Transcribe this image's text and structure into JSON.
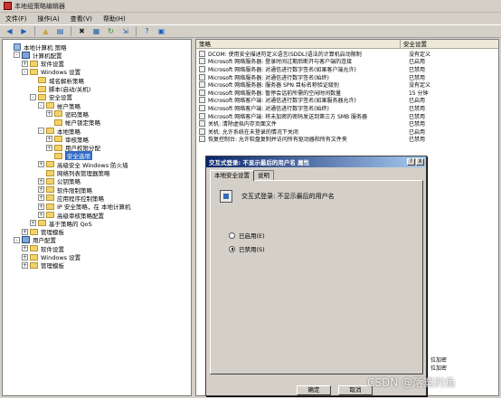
{
  "window": {
    "title": "本地组策略编辑器"
  },
  "menu": [
    "文件(F)",
    "操作(A)",
    "查看(V)",
    "帮助(H)"
  ],
  "toolbar_icons": [
    "back-arrow-icon",
    "forward-arrow-icon",
    "up-folder-icon",
    "show-hide-tree-icon",
    "delete-icon",
    "properties-icon",
    "refresh-icon",
    "export-list-icon",
    "help-icon",
    "help-topics-icon"
  ],
  "tree": [
    {
      "label": "本地计算机 策略",
      "indent": 0,
      "exp": "",
      "icon": "pi"
    },
    {
      "label": "计算机配置",
      "indent": 1,
      "exp": "-",
      "icon": "ci"
    },
    {
      "label": "软件设置",
      "indent": 2,
      "exp": "+",
      "icon": "fi"
    },
    {
      "label": "Windows 设置",
      "indent": 2,
      "exp": "-",
      "icon": "fi"
    },
    {
      "label": "域名解析策略",
      "indent": 3,
      "exp": "",
      "icon": "fi"
    },
    {
      "label": "脚本(启动/关机)",
      "indent": 3,
      "exp": "",
      "icon": "fi"
    },
    {
      "label": "安全设置",
      "indent": 3,
      "exp": "-",
      "icon": "fi"
    },
    {
      "label": "帐户策略",
      "indent": 4,
      "exp": "-",
      "icon": "fi"
    },
    {
      "label": "密码策略",
      "indent": 5,
      "exp": "+",
      "icon": "fi"
    },
    {
      "label": "帐户锁定策略",
      "indent": 5,
      "exp": "",
      "icon": "fi"
    },
    {
      "label": "本地策略",
      "indent": 4,
      "exp": "-",
      "icon": "fi"
    },
    {
      "label": "审核策略",
      "indent": 5,
      "exp": "+",
      "icon": "fi"
    },
    {
      "label": "用户权限分配",
      "indent": 5,
      "exp": "+",
      "icon": "fi"
    },
    {
      "label": "安全选项",
      "indent": 5,
      "exp": "",
      "icon": "fi",
      "selected": true
    },
    {
      "label": "高级安全 Windows 防火墙",
      "indent": 4,
      "exp": "+",
      "icon": "fi"
    },
    {
      "label": "网络列表管理器策略",
      "indent": 4,
      "exp": "",
      "icon": "fi"
    },
    {
      "label": "公钥策略",
      "indent": 4,
      "exp": "+",
      "icon": "fi"
    },
    {
      "label": "软件限制策略",
      "indent": 4,
      "exp": "+",
      "icon": "fi"
    },
    {
      "label": "应用程序控制策略",
      "indent": 4,
      "exp": "+",
      "icon": "fi"
    },
    {
      "label": "IP 安全策略，在 本地计算机",
      "indent": 4,
      "exp": "+",
      "icon": "fi"
    },
    {
      "label": "高级审核策略配置",
      "indent": 4,
      "exp": "+",
      "icon": "fi"
    },
    {
      "label": "基于策略的 QoS",
      "indent": 3,
      "exp": "+",
      "icon": "fi"
    },
    {
      "label": "管理模板",
      "indent": 2,
      "exp": "+",
      "icon": "fi"
    },
    {
      "label": "用户配置",
      "indent": 1,
      "exp": "-",
      "icon": "ci"
    },
    {
      "label": "软件设置",
      "indent": 2,
      "exp": "+",
      "icon": "fi"
    },
    {
      "label": "Windows 设置",
      "indent": 2,
      "exp": "+",
      "icon": "fi"
    },
    {
      "label": "管理模板",
      "indent": 2,
      "exp": "+",
      "icon": "fi"
    }
  ],
  "list": {
    "col_policy": "策略",
    "col_setting": "安全设置",
    "rows": [
      {
        "name": "DCOM: 使用安全描述符定义语言(SDDL)语法的计算机启动限制",
        "value": "没有定义"
      },
      {
        "name": "Microsoft 网络服务器: 登录时间过期后断开与客户端的连接",
        "value": "已启用"
      },
      {
        "name": "Microsoft 网络服务器: 对通信进行数字签名(如果客户端允许)",
        "value": "已禁用"
      },
      {
        "name": "Microsoft 网络服务器: 对通信进行数字签名(始终)",
        "value": "已禁用"
      },
      {
        "name": "Microsoft 网络服务器: 服务器 SPN 目标名称验证级别",
        "value": "没有定义"
      },
      {
        "name": "Microsoft 网络服务器: 暂停会话前所需的空闲时间数量",
        "value": "15 分钟"
      },
      {
        "name": "Microsoft 网络客户端: 对通信进行数字签名(如果服务器允许)",
        "value": "已启用"
      },
      {
        "name": "Microsoft 网络客户端: 对通信进行数字签名(始终)",
        "value": "已禁用"
      },
      {
        "name": "Microsoft 网络客户端: 将未加密的密码发送到第三方 SMB 服务器",
        "value": "已禁用"
      },
      {
        "name": "关机: 清除虚拟内存页面文件",
        "value": "已禁用"
      },
      {
        "name": "关机: 允许系统在未登录的情况下关闭",
        "value": "已启用"
      },
      {
        "name": "恢复控制台: 允许软盘复制并访问所有驱动器和所有文件夹",
        "value": "已禁用"
      }
    ],
    "behind_dialog": [
      "位加密",
      "位加密"
    ]
  },
  "dialog": {
    "title": "交互式登录: 不显示最后的用户名 属性",
    "help_btn": "?",
    "close_btn": "X",
    "tabs": [
      "本地安全设置",
      "说明"
    ],
    "policy_name": "交互式登录: 不显示最后的用户名",
    "radio_enabled": "已启用(E)",
    "radio_disabled": "已禁用(S)",
    "ok": "确定",
    "cancel": "取消"
  },
  "watermark": "CSDN @落寞的鱼"
}
